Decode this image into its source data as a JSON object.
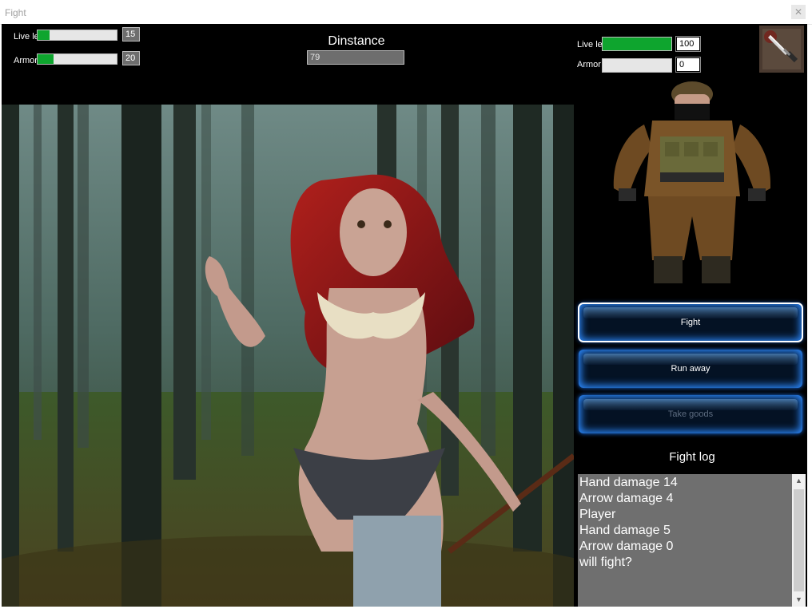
{
  "window": {
    "title": "Fight",
    "close_glyph": "✕"
  },
  "player": {
    "live_label": "Live le",
    "live_value": "15",
    "live_fill": 0.15,
    "armor_label": "Armor",
    "armor_value": "20",
    "armor_fill": 0.2
  },
  "distance": {
    "label": "Dinstance",
    "value": "79"
  },
  "enemy": {
    "live_label": "Live le",
    "live_value": "100",
    "live_fill": 1.0,
    "armor_label": "Armor",
    "armor_value": "0",
    "armor_fill": 0
  },
  "item_slot": {
    "icon": "knife-icon"
  },
  "buttons": {
    "fight": "Fight",
    "run": "Run away",
    "take": "Take goods"
  },
  "log": {
    "title": "Fight log",
    "lines": [
      "Hand damage 14",
      "Arrow damage 4",
      "Player",
      "Hand damage 5",
      "Arrow damage 0",
      "will fight?"
    ]
  },
  "colors": {
    "bar_fill": "#0ea52e",
    "button_glow": "#2c8aff",
    "panel_bg": "#000000"
  }
}
